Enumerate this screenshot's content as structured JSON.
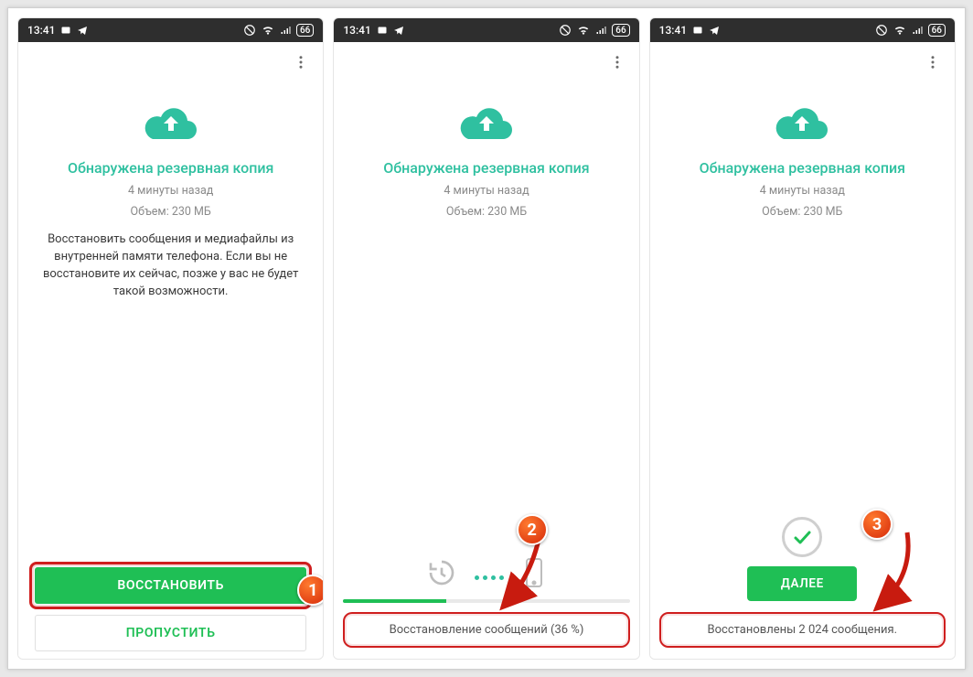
{
  "statusbar": {
    "time": "13:41",
    "battery": "66"
  },
  "common": {
    "title": "Обнаружена резервная копия",
    "time_ago": "4 минуты назад",
    "size_line": "Объем: 230 МБ"
  },
  "screen1": {
    "body": "Восстановить сообщения и медиафайлы из внутренней памяти телефона. Если вы не восстановите их сейчас, позже у вас не будет такой возможности.",
    "restore_btn": "ВОССТАНОВИТЬ",
    "skip_btn": "ПРОПУСТИТЬ",
    "callout": "1"
  },
  "screen2": {
    "progress_text": "Восстановление сообщений (36 %)",
    "progress_pct": 36,
    "callout": "2"
  },
  "screen3": {
    "next_btn": "ДАЛЕЕ",
    "done_text": "Восстановлены 2 024 сообщения.",
    "callout": "3"
  }
}
